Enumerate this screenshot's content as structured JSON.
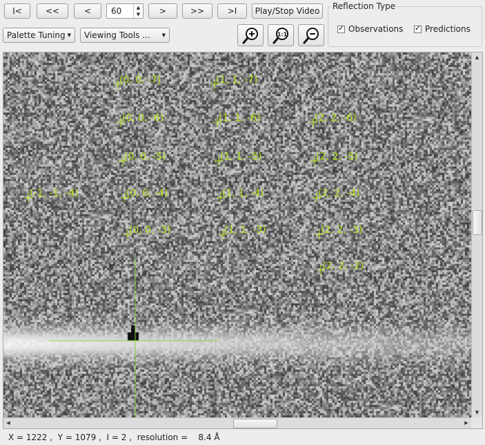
{
  "nav": {
    "first": "I<",
    "back_many": "<<",
    "back": "<",
    "frame_value": "60",
    "forward": ">",
    "forward_many": ">>",
    "last": ">I",
    "play_stop": "Play/Stop Video"
  },
  "menus": {
    "palette": "Palette Tuning",
    "viewing": "Viewing Tools  ..."
  },
  "zoom": {
    "zoom_in_icon": "zoom-in-magnifier",
    "zoom_reset_label": "1:1",
    "zoom_out_icon": "zoom-out-magnifier"
  },
  "reflection_type": {
    "title": "Reflection Type",
    "observations": "Observations",
    "predictions": "Predictions",
    "observations_checked": true,
    "predictions_checked": true
  },
  "viewer": {
    "reflection_labels": [
      "(0, 0, -7)",
      "(1, 1, -7)",
      "(0, 0, -6)",
      "(1, 1, -6)",
      "(2, 2, -6)",
      "(0, 0, -5)",
      "(1, 1, -5)",
      "(2, 2, -5)",
      "(-1, -1, -4)",
      "(0, 0, -4)",
      "(1, 1, -4)",
      "(2, 2, -4)",
      "(0, 0, -3)",
      "(1, 1, -3)",
      "(2, 2, -3)",
      "(2, 2, -2)"
    ],
    "colors": {
      "prediction": "#b5e61d",
      "beam_center": "#7fd23a"
    }
  },
  "status": {
    "x_label": "X = ",
    "x": "1222",
    "y_label": "Y = ",
    "y": "1079",
    "i_label": "I = ",
    "i": "2",
    "res_label": "resolution = ",
    "res": "8.4",
    "res_unit": "Å"
  }
}
